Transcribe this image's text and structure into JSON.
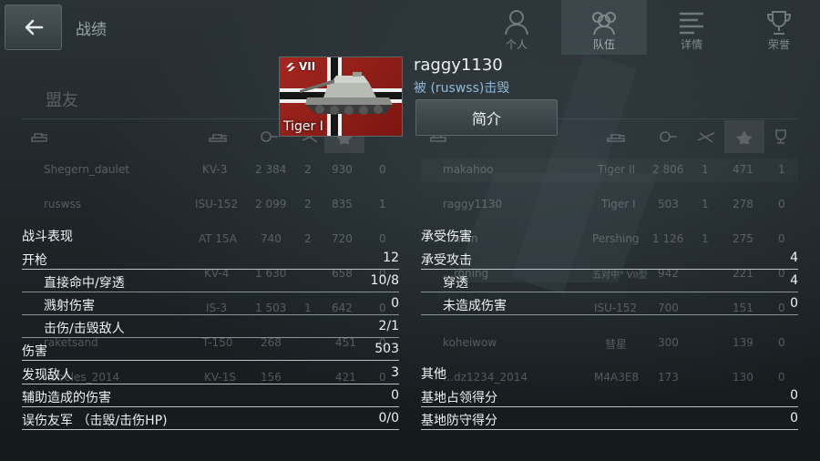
{
  "header": {
    "title": "战绩",
    "tabs": [
      {
        "label": "个人",
        "icon": "person-icon"
      },
      {
        "label": "队伍",
        "icon": "team-icon"
      },
      {
        "label": "详情",
        "icon": "details-icon"
      },
      {
        "label": "荣誉",
        "icon": "trophy-icon"
      }
    ]
  },
  "background": {
    "allies_title": "盟友",
    "allies": [
      {
        "name": "Shegern_daulet",
        "tank": "KV-3",
        "dmg": "2 384",
        "kills": "2",
        "xp": "930",
        "extra": "0"
      },
      {
        "name": "ruswss",
        "tank": "ISU-152",
        "dmg": "2 099",
        "kills": "2",
        "xp": "835",
        "extra": "1"
      },
      {
        "name": "",
        "tank": "AT 15A",
        "dmg": "740",
        "kills": "2",
        "xp": "720",
        "extra": "0"
      },
      {
        "name": "",
        "tank": "KV-4",
        "dmg": "1 630",
        "kills": "",
        "xp": "658",
        "extra": "0"
      },
      {
        "name": "",
        "tank": "IS-3",
        "dmg": "1 503",
        "kills": "1",
        "xp": "642",
        "extra": "0"
      },
      {
        "name": "raketsand",
        "tank": "T-150",
        "dmg": "268",
        "kills": "",
        "xp": "451",
        "extra": "0"
      },
      {
        "name": "Kobeles_2014",
        "tank": "KV-1S",
        "dmg": "156",
        "kills": "",
        "xp": "421",
        "extra": "0"
      }
    ],
    "enemies": [
      {
        "name": "makahoo",
        "tank": "Tiger II",
        "dmg": "2 806",
        "kills": "1",
        "xp": "471",
        "extra": "1"
      },
      {
        "name": "raggy1130",
        "tank": "Tiger I",
        "dmg": "503",
        "kills": "1",
        "xp": "278",
        "extra": "0"
      },
      {
        "name": "…man",
        "tank": "Pershing",
        "dmg": "1 126",
        "kills": "1",
        "xp": "275",
        "extra": "0"
      },
      {
        "name": "…roning",
        "tank": "五对中\" VII型",
        "dmg": "942",
        "kills": "",
        "xp": "221",
        "extra": "0"
      },
      {
        "name": "",
        "tank": "ISU-152",
        "dmg": "700",
        "kills": "",
        "xp": "151",
        "extra": "0"
      },
      {
        "name": "koheiwow",
        "tank": "彗星",
        "dmg": "300",
        "kills": "",
        "xp": "139",
        "extra": "0"
      },
      {
        "name": "…dz1234_2014",
        "tank": "M4A3E8",
        "dmg": "173",
        "kills": "",
        "xp": "130",
        "extra": "0"
      }
    ]
  },
  "vehicle": {
    "tier": "VII",
    "name": "Tiger I"
  },
  "player": {
    "name": "raggy1130",
    "killed_by": "被 (ruswss)击毁",
    "intro_button": "简介"
  },
  "combat": {
    "title": "战斗表现",
    "rows": [
      {
        "label": "开枪",
        "value": "12",
        "sub": false
      },
      {
        "label": "直接命中/穿透",
        "value": "10/8",
        "sub": true
      },
      {
        "label": "溅射伤害",
        "value": "0",
        "sub": true
      },
      {
        "label": "击伤/击毁敌人",
        "value": "2/1",
        "sub": true
      },
      {
        "label": "伤害",
        "value": "503",
        "sub": false
      },
      {
        "label": "发现敌人",
        "value": "3",
        "sub": false
      },
      {
        "label": "辅助造成的伤害",
        "value": "0",
        "sub": false
      },
      {
        "label": "误伤友军 （击毁/击伤HP)",
        "value": "0/0",
        "sub": false
      }
    ]
  },
  "received": {
    "title": "承受伤害",
    "rows": [
      {
        "label": "承受攻击",
        "value": "4",
        "sub": false
      },
      {
        "label": "穿透",
        "value": "4",
        "sub": true
      },
      {
        "label": "未造成伤害",
        "value": "0",
        "sub": true
      }
    ]
  },
  "other": {
    "title": "其他",
    "rows": [
      {
        "label": "基地占领得分",
        "value": "0",
        "sub": false
      },
      {
        "label": "基地防守得分",
        "value": "0",
        "sub": false
      }
    ]
  }
}
